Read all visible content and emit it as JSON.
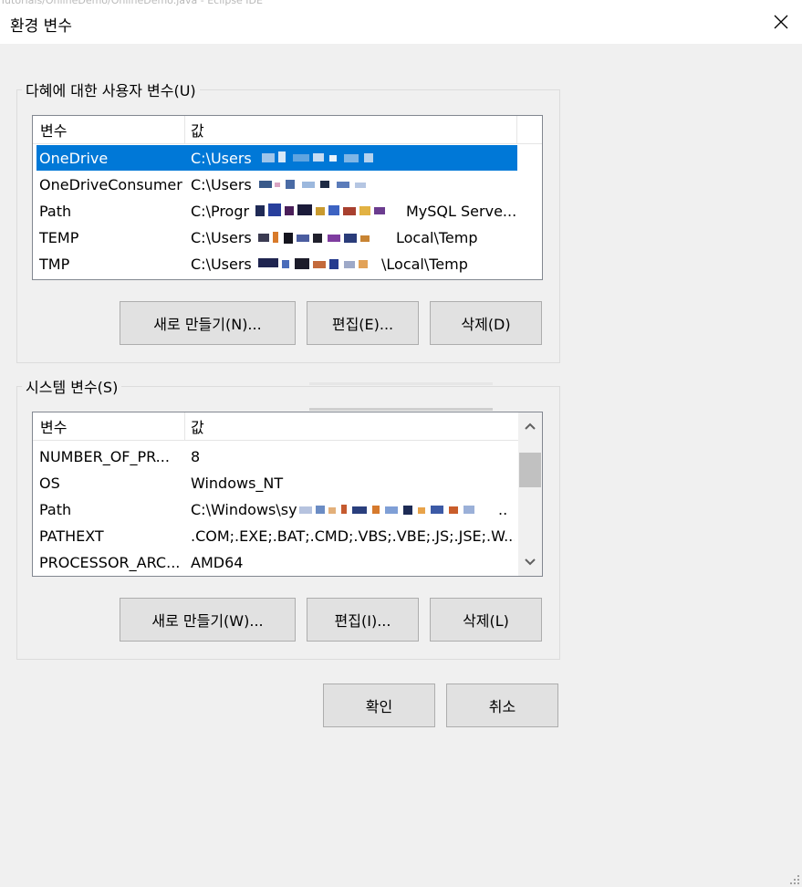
{
  "window": {
    "title": "환경 변수",
    "background_title": "Tutorials/OnlineDemo/OnlineDemo.java - Eclipse IDE"
  },
  "user_vars": {
    "group_title": "다혜에 대한 사용자 변수(U)",
    "header_name": "변수",
    "header_value": "값",
    "rows": [
      {
        "name": "OneDrive",
        "value": "C:\\Users",
        "selected": true
      },
      {
        "name": "OneDriveConsumer",
        "value": "C:\\Users"
      },
      {
        "name": "Path",
        "value": "C:\\Progr",
        "value_tail": "MySQL Serve..."
      },
      {
        "name": "TEMP",
        "value": "C:\\Users",
        "value_tail": "Local\\Temp"
      },
      {
        "name": "TMP",
        "value": "C:\\Users",
        "value_tail": "\\Local\\Temp"
      }
    ],
    "buttons": {
      "new": "새로 만들기(N)...",
      "edit": "편집(E)...",
      "delete": "삭제(D)"
    }
  },
  "system_vars": {
    "group_title": "시스템 변수(S)",
    "header_name": "변수",
    "header_value": "값",
    "rows": [
      {
        "name": "NUMBER_OF_PR...",
        "value": "8"
      },
      {
        "name": "OS",
        "value": "Windows_NT"
      },
      {
        "name": "Path",
        "value": "C:\\Windows\\sy"
      },
      {
        "name": "PATHEXT",
        "value": ".COM;.EXE;.BAT;.CMD;.VBS;.VBE;.JS;.JSE;.W..."
      },
      {
        "name": "PROCESSOR_ARC...",
        "value": "AMD64"
      }
    ],
    "buttons": {
      "new": "새로 만들기(W)...",
      "edit": "편집(I)...",
      "delete": "삭제(L)"
    }
  },
  "dialog_buttons": {
    "ok": "확인",
    "cancel": "취소"
  },
  "colors": {
    "selection": "#0078d7",
    "dialog_bg": "#f0f0f0",
    "button_bg": "#e1e1e1"
  }
}
